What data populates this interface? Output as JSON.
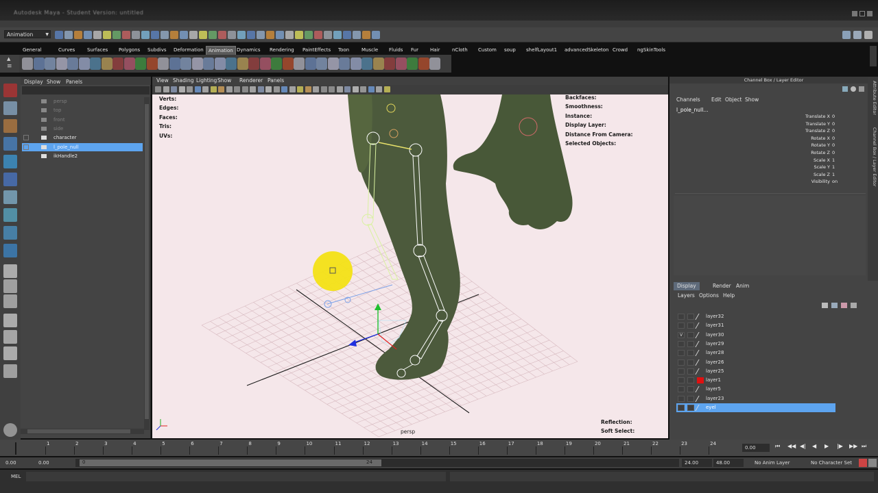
{
  "window": {
    "title": "Autodesk Maya - Student Version: untitled"
  },
  "status_line": {
    "mode": "Animation"
  },
  "shelf": {
    "tabs": [
      "General",
      "Curves",
      "Surfaces",
      "Polygons",
      "Subdivs",
      "Deformation",
      "Animation",
      "Dynamics",
      "Rendering",
      "PaintEffects",
      "Toon",
      "Muscle",
      "Fluids",
      "Fur",
      "Hair",
      "nCloth",
      "Custom",
      "soup",
      "shelfLayout1",
      "advancedSkeleton",
      "Crowd",
      "ngSkinTools"
    ],
    "active_tab": "Animation"
  },
  "outliner": {
    "menu": [
      "Display",
      "Show",
      "Panels"
    ],
    "items": [
      "persp",
      "top",
      "front",
      "side",
      "character",
      "l_pole_null",
      "ikHandle2"
    ],
    "selected": "l_pole_null"
  },
  "viewport": {
    "menu": [
      "View",
      "Shading",
      "Lighting",
      "Show",
      "Renderer",
      "Panels"
    ],
    "hud_left": [
      "Verts:",
      "Edges:",
      "Faces:",
      "Tris:",
      "UVs:"
    ],
    "hud_right": [
      "Backfaces:",
      "Smoothness:",
      "Instance:",
      "Display Layer:",
      "Distance From Camera:",
      "Selected Objects:"
    ],
    "hud_bottom": [
      "Reflection:",
      "Soft Select:"
    ],
    "camera": "persp",
    "colors": {
      "background": "#f5e7ea",
      "mesh": "#4a5a3a",
      "skeleton": "#ffffff",
      "selection": "#f2df1f"
    }
  },
  "channel_box": {
    "header": "Channel Box / Layer Editor",
    "menu": [
      "Channels",
      "Edit",
      "Object",
      "Show"
    ],
    "object": "l_pole_null...",
    "attributes": [
      {
        "name": "Translate X",
        "value": "0"
      },
      {
        "name": "Translate Y",
        "value": "0"
      },
      {
        "name": "Translate Z",
        "value": "0"
      },
      {
        "name": "Rotate X",
        "value": "0"
      },
      {
        "name": "Rotate Y",
        "value": "0"
      },
      {
        "name": "Rotate Z",
        "value": "0"
      },
      {
        "name": "Scale X",
        "value": "1"
      },
      {
        "name": "Scale Y",
        "value": "1"
      },
      {
        "name": "Scale Z",
        "value": "1"
      },
      {
        "name": "Visibility",
        "value": "on"
      }
    ],
    "side_tabs": [
      "Attribute Editor",
      "Channel Box / Layer Editor"
    ]
  },
  "layer_editor": {
    "tabs": [
      "Display",
      "Render",
      "Anim"
    ],
    "active_tab": "Display",
    "menu": [
      "Layers",
      "Options",
      "Help"
    ],
    "layers": [
      {
        "name": "layer32",
        "visible": "",
        "color": ""
      },
      {
        "name": "layer31",
        "visible": "",
        "color": ""
      },
      {
        "name": "layer30",
        "visible": "V",
        "color": ""
      },
      {
        "name": "layer29",
        "visible": "",
        "color": ""
      },
      {
        "name": "layer28",
        "visible": "",
        "color": ""
      },
      {
        "name": "layer26",
        "visible": "",
        "color": ""
      },
      {
        "name": "layer25",
        "visible": "",
        "color": ""
      },
      {
        "name": "layer1",
        "visible": "",
        "color": "#e01010"
      },
      {
        "name": "layer5",
        "visible": "",
        "color": ""
      },
      {
        "name": "layer23",
        "visible": "",
        "color": ""
      },
      {
        "name": "eyel",
        "visible": "",
        "color": ""
      }
    ],
    "selected": "eyel"
  },
  "time_slider": {
    "ticks": [
      "1",
      "2",
      "3",
      "4",
      "5",
      "6",
      "7",
      "8",
      "9",
      "10",
      "11",
      "12",
      "13",
      "14",
      "15",
      "16",
      "17",
      "18",
      "19",
      "20",
      "21",
      "22",
      "23",
      "24"
    ],
    "current_time": "0.00"
  },
  "range_slider": {
    "start": "0.00",
    "playback_start": "0.00",
    "range_start": "0",
    "range_end": "24",
    "playback_end": "24.00",
    "end": "48.00",
    "anim_layer": "No Anim Layer",
    "character_set": "No Character Set"
  },
  "command_line": {
    "label": "MEL"
  }
}
